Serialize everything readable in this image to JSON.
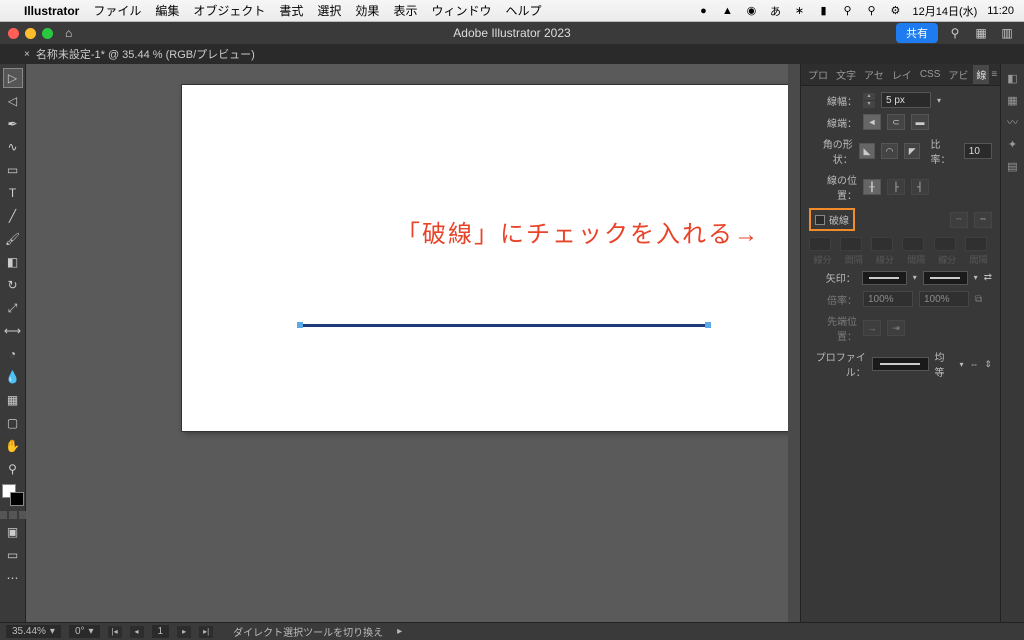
{
  "mac_menu": {
    "app": "Illustrator",
    "items": [
      "ファイル",
      "編集",
      "オブジェクト",
      "書式",
      "選択",
      "効果",
      "表示",
      "ウィンドウ",
      "ヘルプ"
    ],
    "date": "12月14日(水)",
    "time": "11:20"
  },
  "app_titlebar": {
    "title": "Adobe Illustrator 2023",
    "share": "共有"
  },
  "doc_tab": {
    "name": "名称未設定-1* @ 35.44 % (RGB/プレビュー)"
  },
  "annotation_text": "「破線」にチェックを入れる→",
  "panel_tabs": {
    "pro": "プロ",
    "moji": "文字",
    "ase": "アセ",
    "rei": "レイ",
    "css": "CSS",
    "abi": "アビ",
    "sen": "線"
  },
  "stroke_panel": {
    "weight_label": "線幅：",
    "weight_value": "5 px",
    "cap_label": "線端：",
    "corner_label": "角の形状：",
    "miter_label": "比率：",
    "miter_value": "10",
    "align_label": "線の位置：",
    "dashed_label": "破線",
    "dash_headers": [
      "線分",
      "間隔",
      "線分",
      "間隔",
      "線分",
      "間隔"
    ],
    "arrow_label": "矢印：",
    "scale_label": "倍率：",
    "scale_value": "100%",
    "tip_label": "先端位置：",
    "profile_label": "プロファイル：",
    "profile_value": "均等"
  },
  "status": {
    "zoom": "35.44%",
    "rotate": "0°",
    "artboard": "1",
    "hint": "ダイレクト選択ツールを切り換え"
  }
}
